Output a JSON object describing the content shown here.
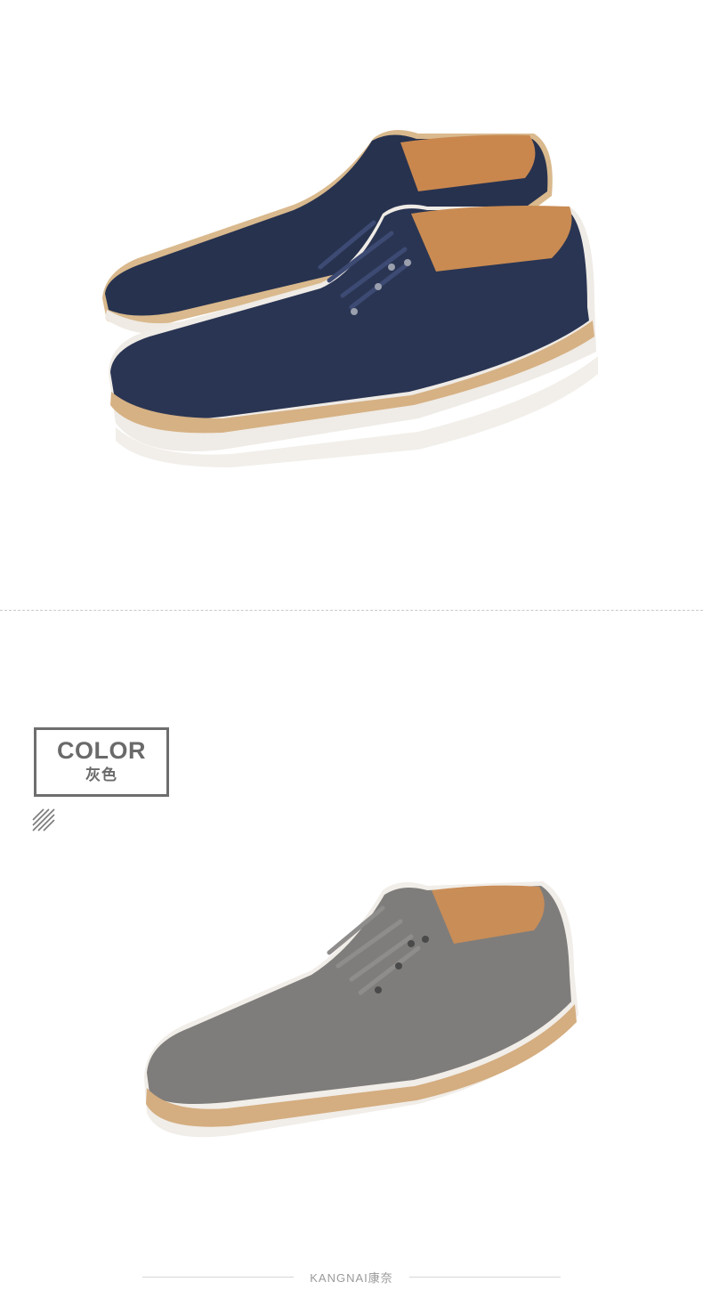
{
  "sections": [
    {
      "name": "navy",
      "color_hex": "#2b3756"
    },
    {
      "name": "grey",
      "color_hex": "#7d7b7a"
    }
  ],
  "color_label": {
    "title": "COLOR",
    "subtitle": "灰色"
  },
  "footer": {
    "brand": "KANGNAI",
    "brand_cn": "康奈"
  },
  "icons": [
    "hatch-icon"
  ]
}
